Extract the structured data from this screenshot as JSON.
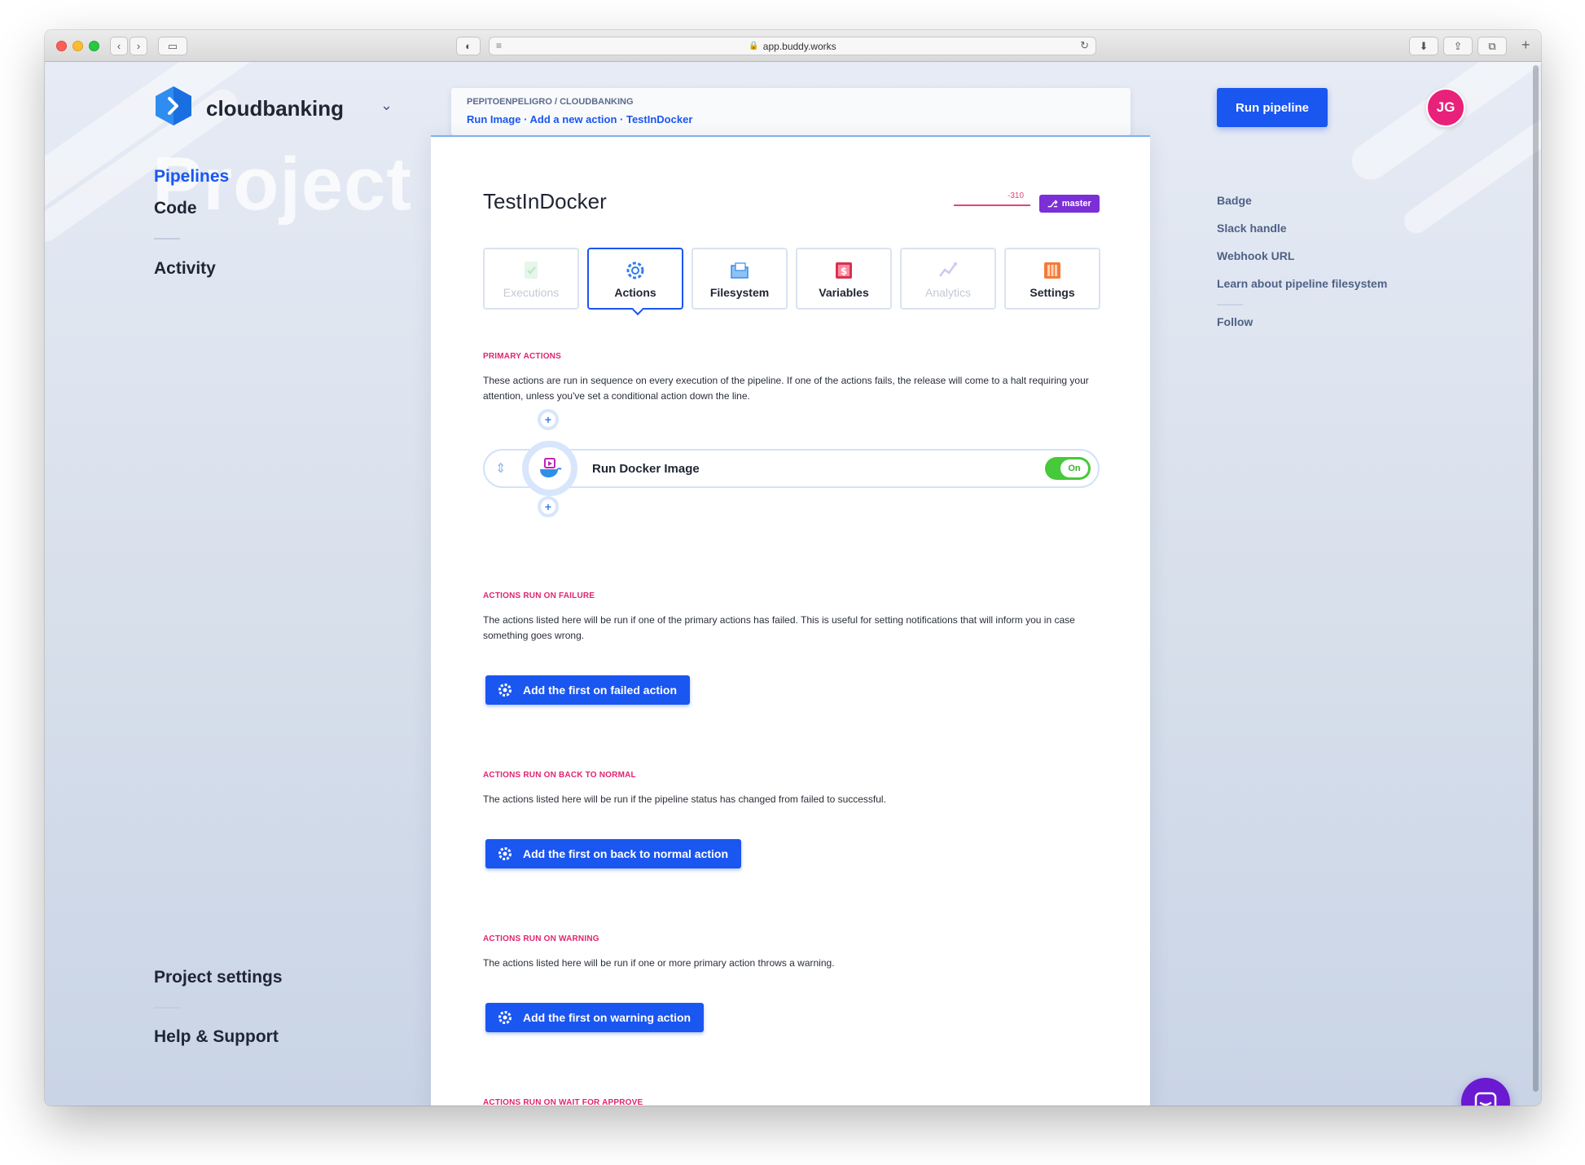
{
  "browser": {
    "url": "app.buddy.works"
  },
  "project": {
    "name": "cloudbanking",
    "ghost_word": "Project"
  },
  "nav": {
    "pipelines": "Pipelines",
    "code": "Code",
    "activity": "Activity",
    "project_settings": "Project settings",
    "help_support": "Help & Support"
  },
  "breadcrumb": {
    "org": "PEPITOENPELIGRO / CLOUDBANKING",
    "trail": "Run Image · Add a new action · TestInDocker"
  },
  "pipeline": {
    "title": "TestInDocker",
    "spark_value": "-310",
    "branch": "master"
  },
  "tabs": [
    {
      "label": "Executions",
      "icon": "executions-icon",
      "state": "disabled"
    },
    {
      "label": "Actions",
      "icon": "actions-gear-icon",
      "state": "active"
    },
    {
      "label": "Filesystem",
      "icon": "filesystem-icon",
      "state": "normal"
    },
    {
      "label": "Variables",
      "icon": "variables-icon",
      "state": "normal"
    },
    {
      "label": "Analytics",
      "icon": "analytics-icon",
      "state": "disabled"
    },
    {
      "label": "Settings",
      "icon": "settings-icon",
      "state": "normal"
    }
  ],
  "sections": {
    "primary": {
      "heading": "PRIMARY ACTIONS",
      "desc": "These actions are run in sequence on every execution of the pipeline. If one of the actions fails, the release will come to a halt requiring your attention, unless you've set a conditional action down the line."
    },
    "failure": {
      "heading": "ACTIONS RUN ON FAILURE",
      "desc": "The actions listed here will be run if one of the primary actions has failed. This is useful for setting notifications that will inform you in case something goes wrong.",
      "button": "Add the first on failed action"
    },
    "back_to_normal": {
      "heading": "ACTIONS RUN ON BACK TO NORMAL",
      "desc": "The actions listed here will be run if the pipeline status has changed from failed to successful.",
      "button": "Add the first on back to normal action"
    },
    "warning": {
      "heading": "ACTIONS RUN ON WARNING",
      "desc": "The actions listed here will be run if one or more primary action throws a warning.",
      "button": "Add the first on warning action"
    },
    "wait_for_approve": {
      "heading": "ACTIONS RUN ON WAIT FOR APPROVE"
    }
  },
  "action": {
    "name": "Run Docker Image",
    "toggle": "On",
    "icon": "docker-icon"
  },
  "sidebar_right": {
    "run_button": "Run pipeline",
    "avatar_initials": "JG",
    "links": [
      "Badge",
      "Slack handle",
      "Webhook URL",
      "Learn about pipeline filesystem"
    ],
    "follow": "Follow"
  },
  "colors": {
    "accent": "#1a56f0",
    "heading_pink": "#e0256f",
    "branch_purple": "#7b2fd6",
    "avatar_pink": "#e8217a",
    "toggle_green": "#46c93a",
    "chat_purple": "#6a1ad0"
  }
}
